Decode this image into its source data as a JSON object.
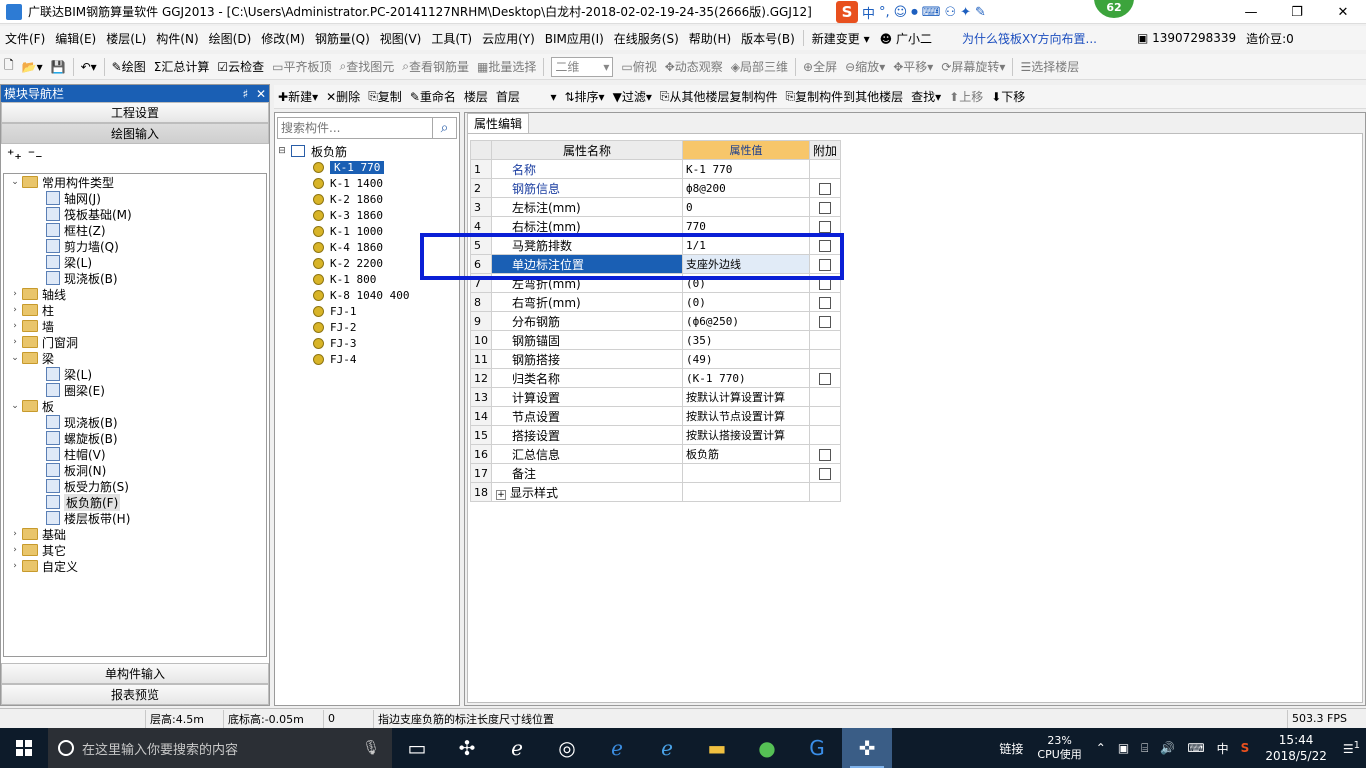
{
  "window": {
    "title": "广联达BIM钢筋算量软件 GGJ2013 - [C:\\Users\\Administrator.PC-20141127NRHM\\Desktop\\白龙村-2018-02-02-19-24-35(2666版).GGJ12]",
    "ime_label": "中",
    "badge_count": "62",
    "min_glyph": "—",
    "max_glyph": "❐",
    "close_glyph": "✕"
  },
  "menu": {
    "items": [
      "文件(F)",
      "编辑(E)",
      "楼层(L)",
      "构件(N)",
      "绘图(D)",
      "修改(M)",
      "钢筋量(Q)",
      "视图(V)",
      "工具(T)",
      "云应用(Y)",
      "BIM应用(I)",
      "在线服务(S)",
      "帮助(H)",
      "版本号(B)"
    ],
    "new_change": "新建变更",
    "assistant": "广小二",
    "question": "为什么筏板XY方向布置...",
    "phone": "13907298339",
    "cost_beans": "造价豆:0"
  },
  "toolbar1": {
    "draw": "绘图",
    "summary_calc": "汇总计算",
    "cloud_check": "云检查",
    "flush_board_top": "平齐板顶",
    "find_element": "查找图元",
    "view_rebar": "查看钢筋量",
    "batch_select": "批量选择",
    "view_mode": "二维",
    "top_view": "俯视",
    "dynamic_view": "动态观察",
    "local_3d": "局部三维",
    "fullscreen": "全屏",
    "zoom": "缩放",
    "pan": "平移",
    "rotate": "屏幕旋转",
    "select_floor": "选择楼层"
  },
  "nav": {
    "header": "模块导航栏",
    "pin": "♯",
    "close": "✕",
    "project_settings": "工程设置",
    "drawing_input": "绘图输入",
    "single_input": "单构件输入",
    "report_preview": "报表预览",
    "tree": [
      {
        "level": 0,
        "toggle": "⌄",
        "type": "folder",
        "label": "常用构件类型"
      },
      {
        "level": 1,
        "toggle": "",
        "type": "item",
        "label": "轴网(J)"
      },
      {
        "level": 1,
        "toggle": "",
        "type": "item",
        "label": "筏板基础(M)"
      },
      {
        "level": 1,
        "toggle": "",
        "type": "item",
        "label": "框柱(Z)"
      },
      {
        "level": 1,
        "toggle": "",
        "type": "item",
        "label": "剪力墙(Q)"
      },
      {
        "level": 1,
        "toggle": "",
        "type": "item",
        "label": "梁(L)"
      },
      {
        "level": 1,
        "toggle": "",
        "type": "item",
        "label": "现浇板(B)"
      },
      {
        "level": 0,
        "toggle": "›",
        "type": "folder",
        "label": "轴线"
      },
      {
        "level": 0,
        "toggle": "›",
        "type": "folder",
        "label": "柱"
      },
      {
        "level": 0,
        "toggle": "›",
        "type": "folder",
        "label": "墙"
      },
      {
        "level": 0,
        "toggle": "›",
        "type": "folder",
        "label": "门窗洞"
      },
      {
        "level": 0,
        "toggle": "⌄",
        "type": "folder",
        "label": "梁"
      },
      {
        "level": 1,
        "toggle": "",
        "type": "item",
        "label": "梁(L)"
      },
      {
        "level": 1,
        "toggle": "",
        "type": "item",
        "label": "圈梁(E)"
      },
      {
        "level": 0,
        "toggle": "⌄",
        "type": "folder",
        "label": "板"
      },
      {
        "level": 1,
        "toggle": "",
        "type": "item",
        "label": "现浇板(B)"
      },
      {
        "level": 1,
        "toggle": "",
        "type": "item",
        "label": "螺旋板(B)"
      },
      {
        "level": 1,
        "toggle": "",
        "type": "item",
        "label": "柱帽(V)"
      },
      {
        "level": 1,
        "toggle": "",
        "type": "item",
        "label": "板洞(N)"
      },
      {
        "level": 1,
        "toggle": "",
        "type": "item",
        "label": "板受力筋(S)"
      },
      {
        "level": 1,
        "toggle": "",
        "type": "item",
        "label": "板负筋(F)",
        "selected": true
      },
      {
        "level": 1,
        "toggle": "",
        "type": "item",
        "label": "楼层板带(H)"
      },
      {
        "level": 0,
        "toggle": "›",
        "type": "folder",
        "label": "基础"
      },
      {
        "level": 0,
        "toggle": "›",
        "type": "folder",
        "label": "其它"
      },
      {
        "level": 0,
        "toggle": "›",
        "type": "folder",
        "label": "自定义"
      }
    ]
  },
  "toolbar2": {
    "new": "新建",
    "delete": "删除",
    "copy": "复制",
    "rename": "重命名",
    "floor_label": "楼层",
    "floor_value": "首层",
    "sort": "排序",
    "filter": "过滤",
    "copy_from_floor": "从其他楼层复制构件",
    "copy_to_floor": "复制构件到其他楼层",
    "find": "查找",
    "move_up": "上移",
    "move_down": "下移"
  },
  "components": {
    "search_placeholder": "搜索构件...",
    "root": "板负筋",
    "items": [
      "K-1 770",
      "K-1 1400",
      "K-2 1860",
      "K-3 1860",
      "K-1 1000",
      "K-4 1860",
      "K-2 2200",
      "K-1 800",
      "K-8 1040 400",
      "FJ-1",
      "FJ-2",
      "FJ-3",
      "FJ-4"
    ],
    "selected_index": 0
  },
  "properties": {
    "tab": "属性编辑",
    "headers": {
      "name": "属性名称",
      "value": "属性值",
      "extra": "附加"
    },
    "rows": [
      {
        "no": "1",
        "name": "名称",
        "value": "K-1 770",
        "blue": true,
        "check": false
      },
      {
        "no": "2",
        "name": "钢筋信息",
        "value": "ф8@200",
        "blue": true,
        "check": true
      },
      {
        "no": "3",
        "name": "左标注(mm)",
        "value": "0",
        "blue": false,
        "check": true
      },
      {
        "no": "4",
        "name": "右标注(mm)",
        "value": "770",
        "blue": false,
        "check": true
      },
      {
        "no": "5",
        "name": "马凳筋排数",
        "value": "1/1",
        "blue": false,
        "check": true
      },
      {
        "no": "6",
        "name": "单边标注位置",
        "value": "支座外边线",
        "blue": false,
        "check": true,
        "selected": true
      },
      {
        "no": "7",
        "name": "左弯折(mm)",
        "value": "(0)",
        "blue": false,
        "check": true
      },
      {
        "no": "8",
        "name": "右弯折(mm)",
        "value": "(0)",
        "blue": false,
        "check": true
      },
      {
        "no": "9",
        "name": "分布钢筋",
        "value": "(ф6@250)",
        "blue": false,
        "check": true
      },
      {
        "no": "10",
        "name": "钢筋锚固",
        "value": "(35)",
        "blue": false,
        "check": false
      },
      {
        "no": "11",
        "name": "钢筋搭接",
        "value": "(49)",
        "blue": false,
        "check": false
      },
      {
        "no": "12",
        "name": "归类名称",
        "value": "(K-1 770)",
        "blue": false,
        "check": true
      },
      {
        "no": "13",
        "name": "计算设置",
        "value": "按默认计算设置计算",
        "blue": false,
        "check": false
      },
      {
        "no": "14",
        "name": "节点设置",
        "value": "按默认节点设置计算",
        "blue": false,
        "check": false
      },
      {
        "no": "15",
        "name": "搭接设置",
        "value": "按默认搭接设置计算",
        "blue": false,
        "check": false
      },
      {
        "no": "16",
        "name": "汇总信息",
        "value": "板负筋",
        "blue": false,
        "check": true
      },
      {
        "no": "17",
        "name": "备注",
        "value": "",
        "blue": false,
        "check": true
      },
      {
        "no": "18",
        "name": "显示样式",
        "value": "",
        "blue": false,
        "check": false,
        "expand": true
      }
    ]
  },
  "status": {
    "floor_height": "层高:4.5m",
    "base_height": "底标高:-0.05m",
    "zero": "0",
    "hint": "指边支座负筋的标注长度尺寸线位置",
    "fps": "503.3 FPS"
  },
  "taskbar": {
    "search_placeholder": "在这里输入你要搜索的内容",
    "link": "链接",
    "cpu_pct": "23%",
    "cpu_label": "CPU使用",
    "ime": "中",
    "time": "15:44",
    "date": "2018/5/22",
    "notif_count": "1"
  }
}
